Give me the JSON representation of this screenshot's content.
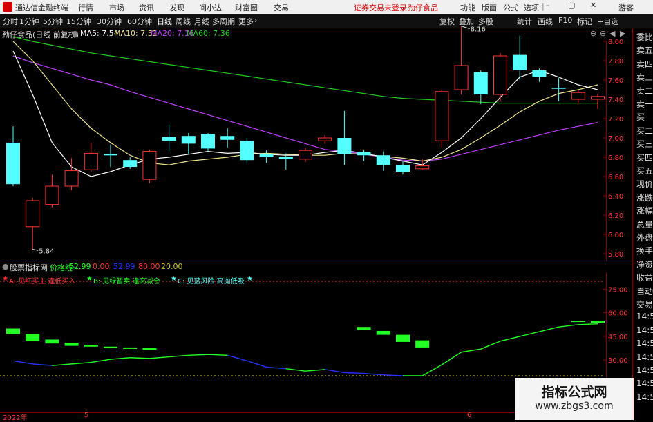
{
  "titlebar": {
    "app_name": "通达信金融终端",
    "menu": [
      "行情",
      "市场",
      "资讯",
      "发现",
      "问小达",
      "财富圈",
      "交易"
    ],
    "notice_trade": "证券交易未登录",
    "notice_stock": "劲仔食品",
    "right_menu": [
      "功能",
      "版面",
      "公式",
      "选项"
    ],
    "guest": "游客"
  },
  "toolbar": {
    "periods": [
      "分时",
      "1分钟",
      "5分钟",
      "15分钟",
      "30分钟",
      "60分钟",
      "日线",
      "周线",
      "月线",
      "多周期",
      "更多"
    ],
    "active_period": "日线",
    "right_buttons": [
      "复权",
      "叠加",
      "多股",
      "统计",
      "画线",
      "F10",
      "标记",
      "+自选"
    ]
  },
  "infobar": {
    "stock_label": "劲仔食品(日线 前复权)",
    "ma5": "MA5: 7.54",
    "ma10": "MA10: 7.51",
    "ma20": "MA20: 7.16",
    "ma60": "MA60: 7.36"
  },
  "colors": {
    "up": "#ff3333",
    "down": "#54ffff",
    "ma5": "#ffffff",
    "ma10": "#f0e68c",
    "ma20": "#c040ff",
    "ma60": "#22cc22",
    "indicator_green": "#22ff22",
    "indicator_blue": "#2233ff"
  },
  "price_axis": [
    "8.00",
    "7.80",
    "7.60",
    "7.40",
    "7.20",
    "7.00",
    "6.80",
    "6.60",
    "6.40",
    "6.20",
    "6.00",
    "5.80"
  ],
  "price_annotations": {
    "high": "8.16",
    "low": "5.84"
  },
  "indicator_header": {
    "name": "股票指标网",
    "label": "价格线:",
    "v1": "52.99",
    "v2": "0.00",
    "v3": "52.99",
    "v4": "80.00",
    "v5": "20.00"
  },
  "legend": {
    "a": "A: 见红买主 逢低买入",
    "b": "B: 见绿暂卖 逢高减仓",
    "c": "C: 见蓝风险 高抛低吸"
  },
  "indicator_axis": [
    "75.00",
    "60.00",
    "45.00",
    "30.00"
  ],
  "date_axis": [
    "2022年",
    "5",
    "6"
  ],
  "sidebar": [
    "委比",
    "卖五",
    "卖四",
    "卖三",
    "卖二",
    "卖一",
    "买一",
    "买二",
    "买三",
    "买四",
    "买五",
    "现价",
    "涨跌",
    "涨幅",
    "总量",
    "外盘",
    "换手",
    "净资",
    "收益",
    "自动",
    "交易",
    "14:5",
    "14:5",
    "14:5",
    "14:5",
    "14:5",
    "14:5",
    "14:5"
  ],
  "watermark": {
    "title": "指标公式网",
    "url": "www.zbgs3.com"
  },
  "chart_data": {
    "type": "candlestick",
    "ylim": [
      5.7,
      8.2
    ],
    "candles": [
      {
        "o": 6.52,
        "c": 6.95,
        "h": 7.12,
        "l": 6.5,
        "up": false
      },
      {
        "o": 6.08,
        "c": 6.35,
        "h": 6.38,
        "l": 5.84,
        "up": true
      },
      {
        "o": 6.31,
        "c": 6.5,
        "h": 6.62,
        "l": 6.28,
        "up": true
      },
      {
        "o": 6.5,
        "c": 6.66,
        "h": 6.79,
        "l": 6.46,
        "up": true
      },
      {
        "o": 6.67,
        "c": 6.84,
        "h": 6.95,
        "l": 6.65,
        "up": true
      },
      {
        "o": 6.83,
        "c": 6.83,
        "h": 6.93,
        "l": 6.7,
        "up": false
      },
      {
        "o": 6.77,
        "c": 6.7,
        "h": 6.8,
        "l": 6.68,
        "up": false
      },
      {
        "o": 6.57,
        "c": 6.86,
        "h": 6.88,
        "l": 6.53,
        "up": true
      },
      {
        "o": 7.01,
        "c": 6.97,
        "h": 7.14,
        "l": 6.86,
        "up": false
      },
      {
        "o": 7.02,
        "c": 6.94,
        "h": 7.05,
        "l": 6.83,
        "up": false
      },
      {
        "o": 7.04,
        "c": 6.89,
        "h": 7.05,
        "l": 6.86,
        "up": false
      },
      {
        "o": 7.02,
        "c": 6.98,
        "h": 7.1,
        "l": 6.9,
        "up": false
      },
      {
        "o": 6.97,
        "c": 6.77,
        "h": 7.0,
        "l": 6.74,
        "up": false
      },
      {
        "o": 6.83,
        "c": 6.8,
        "h": 6.87,
        "l": 6.74,
        "up": false
      },
      {
        "o": 6.8,
        "c": 6.78,
        "h": 6.84,
        "l": 6.67,
        "up": false
      },
      {
        "o": 6.78,
        "c": 6.87,
        "h": 6.9,
        "l": 6.75,
        "up": true
      },
      {
        "o": 6.97,
        "c": 7.0,
        "h": 7.03,
        "l": 6.94,
        "up": true
      },
      {
        "o": 7.0,
        "c": 6.83,
        "h": 7.28,
        "l": 6.72,
        "up": false
      },
      {
        "o": 6.85,
        "c": 6.82,
        "h": 6.88,
        "l": 6.76,
        "up": false
      },
      {
        "o": 6.82,
        "c": 6.72,
        "h": 6.86,
        "l": 6.66,
        "up": false
      },
      {
        "o": 6.72,
        "c": 6.65,
        "h": 6.76,
        "l": 6.62,
        "up": false
      },
      {
        "o": 6.68,
        "c": 6.71,
        "h": 6.78,
        "l": 6.67,
        "up": true
      },
      {
        "o": 6.97,
        "c": 7.48,
        "h": 7.5,
        "l": 6.9,
        "up": true
      },
      {
        "o": 7.5,
        "c": 7.75,
        "h": 8.16,
        "l": 7.45,
        "up": true
      },
      {
        "o": 7.68,
        "c": 7.45,
        "h": 7.7,
        "l": 7.35,
        "up": false
      },
      {
        "o": 7.45,
        "c": 7.85,
        "h": 7.88,
        "l": 7.38,
        "up": true
      },
      {
        "o": 7.86,
        "c": 7.7,
        "h": 8.06,
        "l": 7.6,
        "up": false
      },
      {
        "o": 7.7,
        "c": 7.63,
        "h": 7.72,
        "l": 7.58,
        "up": false
      },
      {
        "o": 7.52,
        "c": 7.52,
        "h": 7.62,
        "l": 7.38,
        "up": false
      },
      {
        "o": 7.4,
        "c": 7.47,
        "h": 7.5,
        "l": 7.36,
        "up": true
      },
      {
        "o": 7.4,
        "c": 7.43,
        "h": 7.46,
        "l": 7.3,
        "up": true
      }
    ],
    "ma5": [
      7.9,
      7.45,
      6.95,
      6.7,
      6.6,
      6.65,
      6.72,
      6.78,
      6.8,
      6.83,
      6.86,
      6.84,
      6.85,
      6.83,
      6.82,
      6.82,
      6.85,
      6.87,
      6.84,
      6.8,
      6.76,
      6.72,
      6.85,
      7.0,
      7.2,
      7.42,
      7.63,
      7.7,
      7.63,
      7.55,
      7.5
    ],
    "ma10": [
      8.0,
      7.8,
      7.55,
      7.3,
      7.1,
      6.95,
      6.82,
      6.74,
      6.72,
      6.76,
      6.78,
      6.8,
      6.83,
      6.84,
      6.83,
      6.82,
      6.82,
      6.84,
      6.83,
      6.81,
      6.79,
      6.76,
      6.8,
      6.88,
      7.0,
      7.13,
      7.27,
      7.38,
      7.46,
      7.5,
      7.55
    ],
    "ma20": [
      7.85,
      7.78,
      7.72,
      7.66,
      7.6,
      7.55,
      7.48,
      7.42,
      7.36,
      7.3,
      7.24,
      7.18,
      7.12,
      7.06,
      7.0,
      6.94,
      6.88,
      6.86,
      6.83,
      6.8,
      6.77,
      6.76,
      6.78,
      6.83,
      6.88,
      6.93,
      6.98,
      7.03,
      7.08,
      7.12,
      7.16
    ],
    "ma60": [
      8.05,
      8.0,
      7.96,
      7.92,
      7.88,
      7.85,
      7.82,
      7.79,
      7.76,
      7.73,
      7.7,
      7.67,
      7.64,
      7.61,
      7.58,
      7.55,
      7.52,
      7.49,
      7.46,
      7.43,
      7.41,
      7.4,
      7.39,
      7.38,
      7.37,
      7.36,
      7.36,
      7.36,
      7.36,
      7.36,
      7.36
    ],
    "indicator": {
      "ylim": [
        20,
        80
      ],
      "line": [
        29.5,
        27.5,
        26.5,
        27.5,
        28.5,
        30.5,
        31.5,
        31.0,
        32.0,
        33.0,
        33.5,
        33.0,
        29.5,
        25.5,
        24.5,
        23.0,
        24.0,
        22.0,
        21.5,
        20.5,
        20.0,
        20.0,
        27.0,
        35.0,
        37.0,
        42.0,
        45.0,
        48.0,
        51.0,
        52.5,
        53.0
      ],
      "line_colors": [
        "blue",
        "blue",
        "blue",
        "green",
        "green",
        "green",
        "green",
        "green",
        "green",
        "green",
        "green",
        "green",
        "blue",
        "blue",
        "blue",
        "green",
        "green",
        "blue",
        "blue",
        "blue",
        "blue",
        "green",
        "green",
        "green",
        "green",
        "green",
        "green",
        "green",
        "green",
        "green",
        "green"
      ],
      "green_bars": [
        {
          "i": 0,
          "top": 50.0,
          "bottom": 46.5
        },
        {
          "i": 1,
          "top": 46.5,
          "bottom": 42.0
        },
        {
          "i": 2,
          "top": 43.0,
          "bottom": 40.5
        },
        {
          "i": 3,
          "top": 41.0,
          "bottom": 39.0
        },
        {
          "i": 4,
          "top": 39.5,
          "bottom": 38.5
        },
        {
          "i": 5,
          "top": 38.5,
          "bottom": 37.5
        },
        {
          "i": 6,
          "top": 38.0,
          "bottom": 37.5
        },
        {
          "i": 7,
          "top": 37.5,
          "bottom": 37.0
        },
        {
          "i": 18,
          "top": 51.0,
          "bottom": 49.0
        },
        {
          "i": 19,
          "top": 48.5,
          "bottom": 46.0
        },
        {
          "i": 20,
          "top": 46.0,
          "bottom": 41.5
        },
        {
          "i": 21,
          "top": 42.5,
          "bottom": 38.0
        },
        {
          "i": 29,
          "top": 55.0,
          "bottom": 54.5
        },
        {
          "i": 30,
          "top": 55.0,
          "bottom": 53.5
        }
      ],
      "dashed_levels": [
        80,
        20
      ]
    }
  }
}
